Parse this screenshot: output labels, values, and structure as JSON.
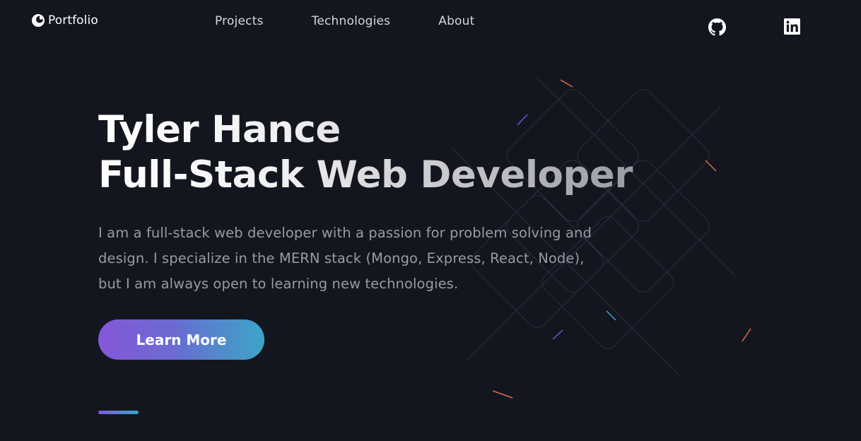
{
  "header": {
    "logo_text": "Portfolio",
    "nav": [
      {
        "label": "Projects"
      },
      {
        "label": "Technologies"
      },
      {
        "label": "About"
      }
    ],
    "social": [
      {
        "icon": "github-icon"
      },
      {
        "icon": "linkedin-icon"
      }
    ]
  },
  "hero": {
    "title_line1": "Tyler Hance",
    "title_line2": "Full-Stack Web Developer",
    "description": "I am a full-stack web developer with a passion for problem solving and design. I specialize in the MERN stack (Mongo, Express, React, Node), but I am always open to learning new technologies.",
    "cta_label": "Learn More"
  },
  "colors": {
    "background": "#13161f",
    "accent_start": "#8457d9",
    "accent_end": "#3ba6c6",
    "text_muted": "#9a9aa4"
  }
}
